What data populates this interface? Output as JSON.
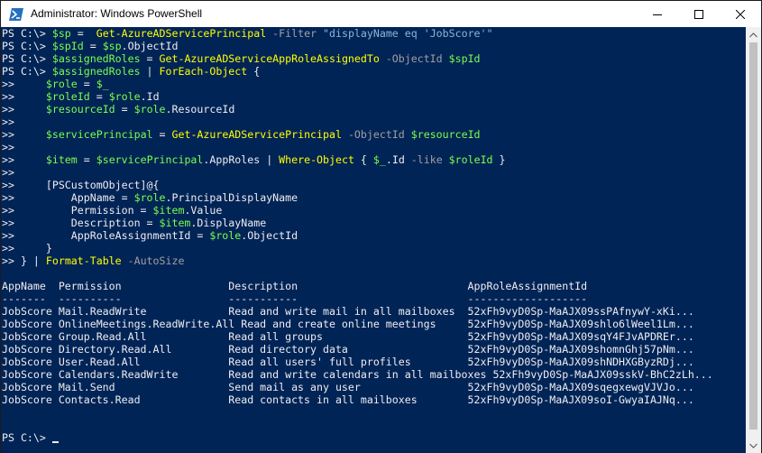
{
  "window": {
    "title": "Administrator: Windows PowerShell",
    "icon": "powershell-icon",
    "controls": [
      "minimize-icon",
      "maximize-icon",
      "close-icon"
    ]
  },
  "colors": {
    "console_bg": "#012456",
    "command": "#ffff00",
    "variable": "#79ff4d",
    "string": "#8fb4d8",
    "parameter": "#a0a0a0",
    "text": "#eeedf0"
  },
  "console": {
    "lines": [
      [
        {
          "t": "PS C:\\> ",
          "c": "plain"
        },
        {
          "t": "$sp",
          "c": "var"
        },
        {
          "t": " = ",
          "c": "plain"
        },
        {
          "t": " Get-AzureADServicePrincipal",
          "c": "cmd"
        },
        {
          "t": " -Filter ",
          "c": "param"
        },
        {
          "t": "\"displayName eq 'JobScore'\"",
          "c": "str"
        }
      ],
      [
        {
          "t": "PS C:\\> ",
          "c": "plain"
        },
        {
          "t": "$spId",
          "c": "var"
        },
        {
          "t": " = ",
          "c": "plain"
        },
        {
          "t": "$sp",
          "c": "var"
        },
        {
          "t": ".ObjectId",
          "c": "plain"
        }
      ],
      [
        {
          "t": "PS C:\\> ",
          "c": "plain"
        },
        {
          "t": "$assignedRoles",
          "c": "var"
        },
        {
          "t": " = ",
          "c": "plain"
        },
        {
          "t": "Get-AzureADServiceAppRoleAssignedTo",
          "c": "cmd"
        },
        {
          "t": " -ObjectId ",
          "c": "param"
        },
        {
          "t": "$spId",
          "c": "var"
        }
      ],
      [
        {
          "t": "PS C:\\> ",
          "c": "plain"
        },
        {
          "t": "$assignedRoles",
          "c": "var"
        },
        {
          "t": " | ",
          "c": "plain"
        },
        {
          "t": "ForEach-Object",
          "c": "cmd"
        },
        {
          "t": " {",
          "c": "plain"
        }
      ],
      [
        {
          "t": ">>     ",
          "c": "plain"
        },
        {
          "t": "$role",
          "c": "var"
        },
        {
          "t": " = ",
          "c": "plain"
        },
        {
          "t": "$_",
          "c": "var"
        }
      ],
      [
        {
          "t": ">>     ",
          "c": "plain"
        },
        {
          "t": "$roleId",
          "c": "var"
        },
        {
          "t": " = ",
          "c": "plain"
        },
        {
          "t": "$role",
          "c": "var"
        },
        {
          "t": ".Id",
          "c": "plain"
        }
      ],
      [
        {
          "t": ">>     ",
          "c": "plain"
        },
        {
          "t": "$resourceId",
          "c": "var"
        },
        {
          "t": " = ",
          "c": "plain"
        },
        {
          "t": "$role",
          "c": "var"
        },
        {
          "t": ".ResourceId",
          "c": "plain"
        }
      ],
      [
        {
          "t": ">>",
          "c": "plain"
        }
      ],
      [
        {
          "t": ">>     ",
          "c": "plain"
        },
        {
          "t": "$servicePrincipal",
          "c": "var"
        },
        {
          "t": " = ",
          "c": "plain"
        },
        {
          "t": "Get-AzureADServicePrincipal",
          "c": "cmd"
        },
        {
          "t": " -ObjectId ",
          "c": "param"
        },
        {
          "t": "$resourceId",
          "c": "var"
        }
      ],
      [
        {
          "t": ">>",
          "c": "plain"
        }
      ],
      [
        {
          "t": ">>     ",
          "c": "plain"
        },
        {
          "t": "$item",
          "c": "var"
        },
        {
          "t": " = ",
          "c": "plain"
        },
        {
          "t": "$servicePrincipal",
          "c": "var"
        },
        {
          "t": ".AppRoles | ",
          "c": "plain"
        },
        {
          "t": "Where-Object",
          "c": "cmd"
        },
        {
          "t": " { ",
          "c": "plain"
        },
        {
          "t": "$_",
          "c": "var"
        },
        {
          "t": ".Id ",
          "c": "plain"
        },
        {
          "t": "-like ",
          "c": "param"
        },
        {
          "t": "$roleId",
          "c": "var"
        },
        {
          "t": " }",
          "c": "plain"
        }
      ],
      [
        {
          "t": ">>",
          "c": "plain"
        }
      ],
      [
        {
          "t": ">>     [PSCustomObject]@{",
          "c": "plain"
        }
      ],
      [
        {
          "t": ">>         AppName = ",
          "c": "plain"
        },
        {
          "t": "$role",
          "c": "var"
        },
        {
          "t": ".PrincipalDisplayName",
          "c": "plain"
        }
      ],
      [
        {
          "t": ">>         Permission = ",
          "c": "plain"
        },
        {
          "t": "$item",
          "c": "var"
        },
        {
          "t": ".Value",
          "c": "plain"
        }
      ],
      [
        {
          "t": ">>         Description = ",
          "c": "plain"
        },
        {
          "t": "$item",
          "c": "var"
        },
        {
          "t": ".DisplayName",
          "c": "plain"
        }
      ],
      [
        {
          "t": ">>         AppRoleAssignmentId = ",
          "c": "plain"
        },
        {
          "t": "$role",
          "c": "var"
        },
        {
          "t": ".ObjectId",
          "c": "plain"
        }
      ],
      [
        {
          "t": ">>     }",
          "c": "plain"
        }
      ],
      [
        {
          "t": ">> } | ",
          "c": "plain"
        },
        {
          "t": "Format-Table",
          "c": "cmd"
        },
        {
          "t": " -AutoSize",
          "c": "param"
        }
      ],
      [
        {
          "t": "",
          "c": "plain"
        }
      ],
      [
        {
          "t": "AppName  Permission                 Description                           AppRoleAssignmentId",
          "c": "plain"
        }
      ],
      [
        {
          "t": "-------  ----------                 -----------                           -------------------",
          "c": "plain"
        }
      ],
      [
        {
          "t": "JobScore Mail.ReadWrite             Read and write mail in all mailboxes  52xFh9vyD0Sp-MaAJX09ssPAfnywY-xKi...",
          "c": "plain"
        }
      ],
      [
        {
          "t": "JobScore OnlineMeetings.ReadWrite.All Read and create online meetings     52xFh9vyD0Sp-MaAJX09shlo6lWeel1Lm...",
          "c": "plain"
        }
      ],
      [
        {
          "t": "JobScore Group.Read.All             Read all groups                       52xFh9vyD0Sp-MaAJX09sqY4FJvAPDREr...",
          "c": "plain"
        }
      ],
      [
        {
          "t": "JobScore Directory.Read.All         Read directory data                   52xFh9vyD0Sp-MaAJX09shomnGhj57pNm...",
          "c": "plain"
        }
      ],
      [
        {
          "t": "JobScore User.Read.All              Read all users' full profiles         52xFh9vyD0Sp-MaAJX09shNDHXGByzRDj...",
          "c": "plain"
        }
      ],
      [
        {
          "t": "JobScore Calendars.ReadWrite        Read and write calendars in all mailboxes 52xFh9vyD0Sp-MaAJX09sskV-BhC2zLh...",
          "c": "plain"
        }
      ],
      [
        {
          "t": "JobScore Mail.Send                  Send mail as any user                 52xFh9vyD0Sp-MaAJX09sqegxewgVJVJo...",
          "c": "plain"
        }
      ],
      [
        {
          "t": "JobScore Contacts.Read              Read contacts in all mailboxes        52xFh9vyD0Sp-MaAJX09soI-GwyaIAJNq...",
          "c": "plain"
        }
      ],
      [
        {
          "t": "",
          "c": "plain"
        }
      ],
      [
        {
          "t": "",
          "c": "plain"
        }
      ],
      [
        {
          "t": "PS C:\\> ",
          "c": "plain"
        }
      ]
    ]
  }
}
